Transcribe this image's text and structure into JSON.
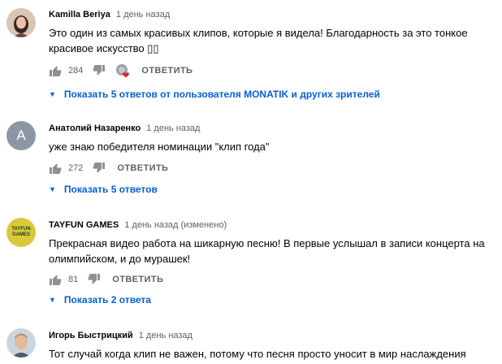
{
  "comments": [
    {
      "author": "Kamilla Beriya",
      "time": "1 день назад",
      "text": "Это один из самых красивых клипов, которые я видела! Благодарность за это тонкое красивое искусство ▯▯",
      "likes": "284",
      "reply_label": "ОТВЕТИТЬ",
      "replies": "Показать 5 ответов от пользователя MONATIK и других зрителей"
    },
    {
      "author": "Анатолий Назаренко",
      "time": "1 день назад",
      "avatar_letter": "A",
      "text": "уже знаю победителя номинации \"клип года\"",
      "likes": "272",
      "reply_label": "ОТВЕТИТЬ",
      "replies": "Показать 5 ответов"
    },
    {
      "author": "TAYFUN GAMES",
      "time": "1 день назад (изменено)",
      "avatar_text": "TAYFUN GAMES",
      "text": "Прекрасная видео работа на шикарную песню! В первые услышал в записи концерта на олимпийском, и до мурашек!",
      "likes": "81",
      "reply_label": "ОТВЕТИТЬ",
      "replies": "Показать 2 ответа"
    },
    {
      "author": "Игорь Быстрицкий",
      "time": "1 день назад",
      "text": "Тот случай когда клип не важен, потому что песня просто уносит в мир наслаждения"
    }
  ],
  "colors": {
    "link": "#065fd4",
    "secondary": "#606060",
    "avatar_gray": "#8c97a5",
    "heart": "#e01b24"
  }
}
